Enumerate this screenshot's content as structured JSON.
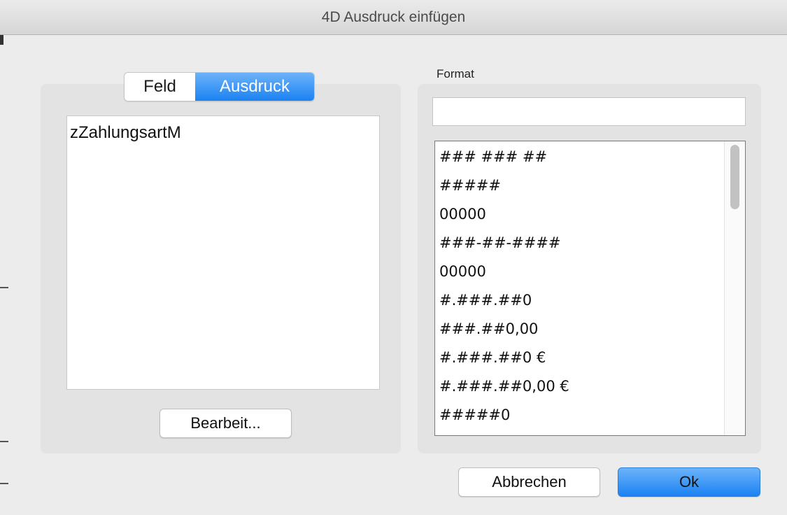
{
  "window": {
    "title": "4D Ausdruck einfügen"
  },
  "source_tabs": [
    {
      "label": "Feld",
      "selected": false
    },
    {
      "label": "Ausdruck",
      "selected": true
    }
  ],
  "expression": {
    "text": "zZahlungsartM"
  },
  "edit_button": {
    "label": "Bearbeit..."
  },
  "format": {
    "label": "Format",
    "input_value": "",
    "options": [
      "### ### ##",
      "#####",
      "00000",
      "###-##-####",
      "00000",
      "#.###.##0",
      "###.##0,00",
      "#.###.##0 €",
      "#.###.##0,00 €",
      "#####0"
    ]
  },
  "buttons": {
    "cancel": "Abbrechen",
    "ok": "Ok"
  },
  "colors": {
    "accent": "#1b82f2",
    "window_bg": "#ececec",
    "pane_bg": "#e3e3e3"
  }
}
